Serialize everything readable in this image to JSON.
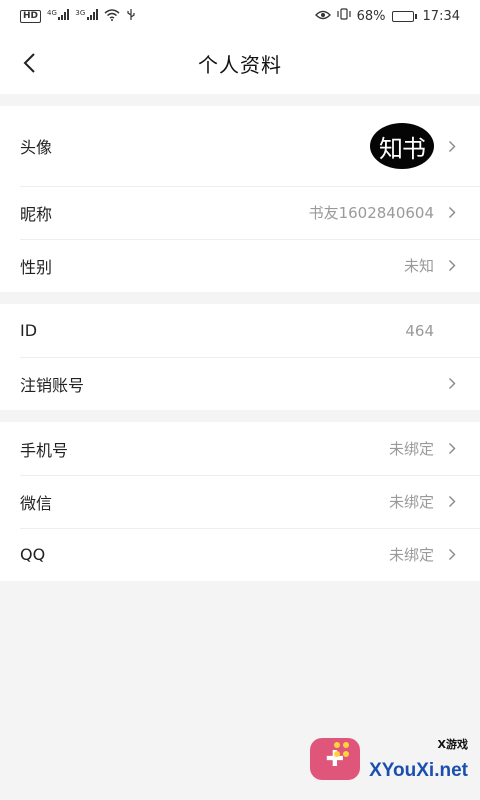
{
  "status_bar": {
    "hd_badge": "HD",
    "net1": "4G",
    "net2": "3G",
    "battery_percent_text": "68%",
    "battery_level": 0.68,
    "time": "17:34"
  },
  "header": {
    "title": "个人资料",
    "back_icon": "chevron-left-icon"
  },
  "groups": [
    {
      "rows": [
        {
          "label": "头像",
          "avatar_text": "知书",
          "has_arrow": true
        },
        {
          "label": "昵称",
          "value": "书友1602840604",
          "has_arrow": true
        },
        {
          "label": "性别",
          "value": "未知",
          "has_arrow": true
        }
      ]
    },
    {
      "rows": [
        {
          "label": "ID",
          "value": "464",
          "has_arrow": false
        },
        {
          "label": "注销账号",
          "value": "",
          "has_arrow": true
        }
      ]
    },
    {
      "rows": [
        {
          "label": "手机号",
          "value": "未绑定",
          "has_arrow": true
        },
        {
          "label": "微信",
          "value": "未绑定",
          "has_arrow": true
        },
        {
          "label": "QQ",
          "value": "未绑定",
          "has_arrow": true
        }
      ]
    }
  ],
  "watermark": {
    "small_text": "X游戏",
    "brand_text": "XYouXi.net"
  },
  "colors": {
    "background": "#f4f4f4",
    "value_gray": "#9a9a9a",
    "avatar_bg": "#050505"
  }
}
